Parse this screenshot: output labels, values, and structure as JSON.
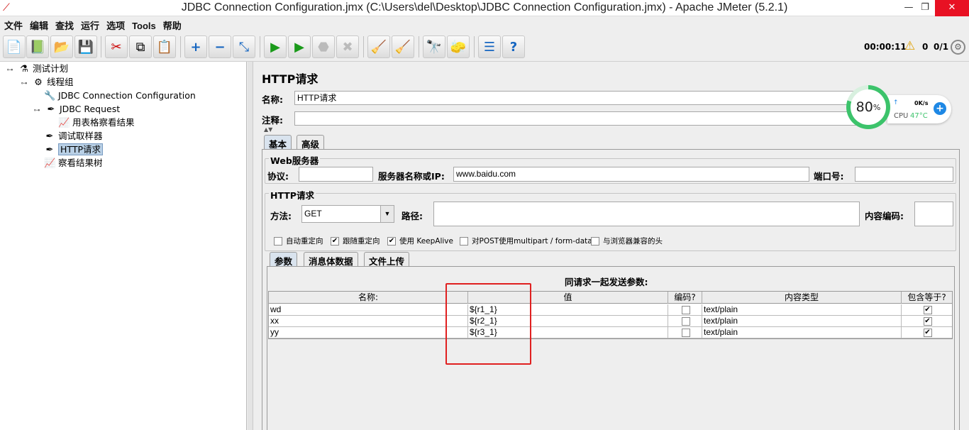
{
  "window": {
    "title": "JDBC Connection Configuration.jmx (C:\\Users\\del\\Desktop\\JDBC Connection Configuration.jmx) - Apache JMeter (5.2.1)",
    "minimize": "—",
    "maximize": "❐",
    "close": "✕"
  },
  "menu": [
    "文件",
    "编辑",
    "查找",
    "运行",
    "选项",
    "Tools",
    "帮助"
  ],
  "status": {
    "timer": "00:00:11",
    "warnings": "0",
    "threads": "0/1"
  },
  "tree": [
    {
      "label": "测试计划",
      "icon": "flask-icon"
    },
    {
      "label": "线程组",
      "icon": "gear-icon"
    },
    {
      "label": "JDBC Connection Configuration",
      "icon": "wrench-icon"
    },
    {
      "label": "JDBC Request",
      "icon": "pipette-icon"
    },
    {
      "label": "用表格察看结果",
      "icon": "chart-icon"
    },
    {
      "label": "调试取样器",
      "icon": "pipette-icon"
    },
    {
      "label": "HTTP请求",
      "icon": "pipette-icon",
      "selected": true
    },
    {
      "label": "察看结果树",
      "icon": "chart-icon"
    }
  ],
  "panel": {
    "heading": "HTTP请求",
    "name_label": "名称:",
    "name_value": "HTTP请求",
    "comment_label": "注释:",
    "comment_value": "",
    "tabs": [
      "基本",
      "高级"
    ],
    "web_server": {
      "legend": "Web服务器",
      "protocol_label": "协议:",
      "protocol_value": "",
      "server_label": "服务器名称或IP:",
      "server_value": "www.baidu.com",
      "port_label": "端口号:",
      "port_value": ""
    },
    "http_request": {
      "legend": "HTTP请求",
      "method_label": "方法:",
      "method_value": "GET",
      "path_label": "路径:",
      "path_value": "",
      "encoding_label": "内容编码:",
      "encoding_value": ""
    },
    "options": [
      {
        "label": "自动重定向",
        "checked": false
      },
      {
        "label": "跟随重定向",
        "checked": true
      },
      {
        "label": "使用 KeepAlive",
        "checked": true
      },
      {
        "label": "对POST使用multipart / form-data",
        "checked": false
      },
      {
        "label": "与浏览器兼容的头",
        "checked": false
      }
    ],
    "subtabs": [
      "参数",
      "消息体数据",
      "文件上传"
    ],
    "params_title": "同请求一起发送参数:",
    "columns": [
      "名称:",
      "值",
      "编码?",
      "内容类型",
      "包含等于?"
    ],
    "rows": [
      {
        "name": "wd",
        "value": "${r1_1}",
        "encode": false,
        "content_type": "text/plain",
        "include_equals": true
      },
      {
        "name": "xx",
        "value": "${r2_1}",
        "encode": false,
        "content_type": "text/plain",
        "include_equals": true
      },
      {
        "name": "yy",
        "value": "${r3_1}",
        "encode": false,
        "content_type": "text/plain",
        "include_equals": true
      }
    ]
  },
  "widget": {
    "percent": "80",
    "percent_unit": "%",
    "net_speed": "0K/s",
    "cpu_label": "CPU",
    "cpu_temp": "47°C"
  },
  "colors": {
    "accent": "#3cc36b",
    "selection": "#b8cfe5",
    "highlight_box": "#e02020"
  }
}
